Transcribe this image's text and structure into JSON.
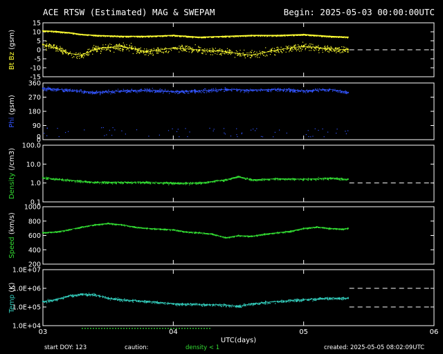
{
  "header": {
    "title": "ACE RTSW (Estimated) MAG & SWEPAM",
    "begin": "Begin: 2025-05-03 00:00:00UTC"
  },
  "footer": {
    "start_doy": "start DOY: 123",
    "caution": "caution:",
    "density_note": "density < 1",
    "created": "created: 2025-05-05 08:02:09UTC"
  },
  "colors": {
    "background": "#000000",
    "bt_bz": "#ffff33",
    "phi": "#3355ff",
    "density": "#33dd33",
    "speed": "#33dd33",
    "temp": "#33ccbb",
    "axes": "#ffffff"
  },
  "chart_data": {
    "type": "scatter",
    "xlabel": "UTC(days)",
    "xlim": [
      3,
      6
    ],
    "x_ticks": [
      "03",
      "04",
      "05",
      "06"
    ],
    "data_ends_at_day": 5.34,
    "panels": [
      {
        "id": "btbz",
        "ylabel_parts": [
          "Bt",
          "Bz",
          "(gsm)"
        ],
        "ylabel_colors": [
          "#ffff33",
          "#ffff33",
          "#ffffff"
        ],
        "ylim": [
          -15,
          15
        ],
        "ticks": [
          "15",
          "10",
          "5",
          "0",
          "-5",
          "-10",
          "-15"
        ],
        "tick_values": [
          15,
          10,
          5,
          0,
          -5,
          -10,
          -15
        ],
        "dashed_lines": [
          0
        ],
        "series": [
          {
            "name": "Bt",
            "x": [
              3.0,
              3.1,
              3.2,
              3.3,
              3.4,
              3.6,
              3.8,
              4.0,
              4.2,
              4.4,
              4.6,
              4.8,
              5.0,
              5.2,
              5.34
            ],
            "values": [
              10.5,
              10.2,
              9.5,
              8.5,
              8.0,
              7.5,
              7.5,
              8.0,
              7.0,
              7.5,
              8.0,
              8.0,
              8.5,
              7.5,
              7.0
            ]
          },
          {
            "name": "Bz",
            "x": [
              3.0,
              3.1,
              3.2,
              3.3,
              3.4,
              3.6,
              3.8,
              4.0,
              4.2,
              4.4,
              4.6,
              4.8,
              5.0,
              5.2,
              5.34
            ],
            "values": [
              3.0,
              1.0,
              -2.0,
              -3.0,
              0.5,
              2.0,
              -1.0,
              1.0,
              0.0,
              -1.0,
              -3.0,
              0.0,
              2.0,
              0.5,
              0.0
            ]
          }
        ]
      },
      {
        "id": "phi",
        "ylabel_parts": [
          "Phi",
          "(gsm)"
        ],
        "ylabel_colors": [
          "#3355ff",
          "#ffffff"
        ],
        "ylim": [
          0,
          360
        ],
        "ticks": [
          "360",
          "270",
          "180",
          "90",
          "0"
        ],
        "tick_values": [
          360,
          270,
          180,
          90,
          0
        ],
        "extra_ticks": [
          "0"
        ],
        "extra_tick_values": [
          20
        ],
        "dashed_lines": [],
        "series": [
          {
            "name": "Phi",
            "x": [
              3.0,
              3.2,
              3.4,
              3.6,
              3.8,
              4.0,
              4.2,
              4.4,
              4.6,
              4.8,
              5.0,
              5.2,
              5.34
            ],
            "values": [
              325,
              315,
              300,
              310,
              315,
              305,
              310,
              320,
              315,
              320,
              310,
              320,
              300
            ]
          }
        ]
      },
      {
        "id": "density",
        "ylabel_parts": [
          "Density",
          "(/cm3)"
        ],
        "ylabel_colors": [
          "#33dd33",
          "#ffffff"
        ],
        "scale": "log",
        "ylim": [
          0.1,
          100
        ],
        "ticks": [
          "100.0",
          "10.0",
          "1.0",
          "0.1"
        ],
        "tick_values": [
          100,
          10,
          1,
          0.1
        ],
        "dashed_lines": [
          1
        ],
        "series": [
          {
            "name": "Density",
            "x": [
              3.0,
              3.2,
              3.4,
              3.6,
              3.8,
              4.0,
              4.2,
              4.4,
              4.5,
              4.6,
              4.8,
              5.0,
              5.2,
              5.34
            ],
            "values": [
              1.9,
              1.4,
              1.1,
              1.1,
              1.1,
              1.0,
              1.0,
              1.5,
              2.2,
              1.5,
              1.7,
              1.6,
              1.8,
              1.6
            ]
          }
        ]
      },
      {
        "id": "speed",
        "ylabel_parts": [
          "Speed",
          "(km/s)"
        ],
        "ylabel_colors": [
          "#33dd33",
          "#ffffff"
        ],
        "ylim": [
          200,
          1000
        ],
        "ticks": [
          "1000",
          "800",
          "600",
          "400",
          "200"
        ],
        "tick_values": [
          1000,
          800,
          600,
          400,
          200
        ],
        "dashed_lines": [],
        "series": [
          {
            "name": "Speed",
            "x": [
              3.0,
              3.1,
              3.2,
              3.3,
              3.4,
              3.5,
              3.6,
              3.7,
              3.8,
              3.9,
              4.0,
              4.1,
              4.2,
              4.3,
              4.4,
              4.5,
              4.6,
              4.7,
              4.8,
              4.9,
              5.0,
              5.1,
              5.2,
              5.3,
              5.34
            ],
            "values": [
              640,
              650,
              680,
              720,
              750,
              770,
              750,
              720,
              700,
              690,
              680,
              650,
              640,
              620,
              570,
              600,
              590,
              620,
              640,
              660,
              700,
              720,
              700,
              690,
              700
            ]
          }
        ]
      },
      {
        "id": "temp",
        "ylabel_parts": [
          "Temp",
          "(K)"
        ],
        "ylabel_colors": [
          "#33ccbb",
          "#ffffff"
        ],
        "scale": "log",
        "ylim": [
          10000,
          10000000
        ],
        "ticks": [
          "1.0E+07",
          "1.0E+06",
          "1.0E+05",
          "1.0E+04"
        ],
        "tick_values": [
          10000000,
          1000000,
          100000,
          10000
        ],
        "dashed_lines": [
          1000000,
          100000
        ],
        "series": [
          {
            "name": "Temp",
            "x": [
              3.0,
              3.1,
              3.2,
              3.3,
              3.4,
              3.5,
              3.6,
              3.8,
              4.0,
              4.2,
              4.4,
              4.5,
              4.6,
              4.8,
              5.0,
              5.2,
              5.34
            ],
            "values": [
              200000,
              250000,
              400000,
              500000,
              450000,
              300000,
              250000,
              200000,
              150000,
              140000,
              130000,
              110000,
              150000,
              200000,
              250000,
              300000,
              300000
            ]
          }
        ]
      }
    ]
  }
}
